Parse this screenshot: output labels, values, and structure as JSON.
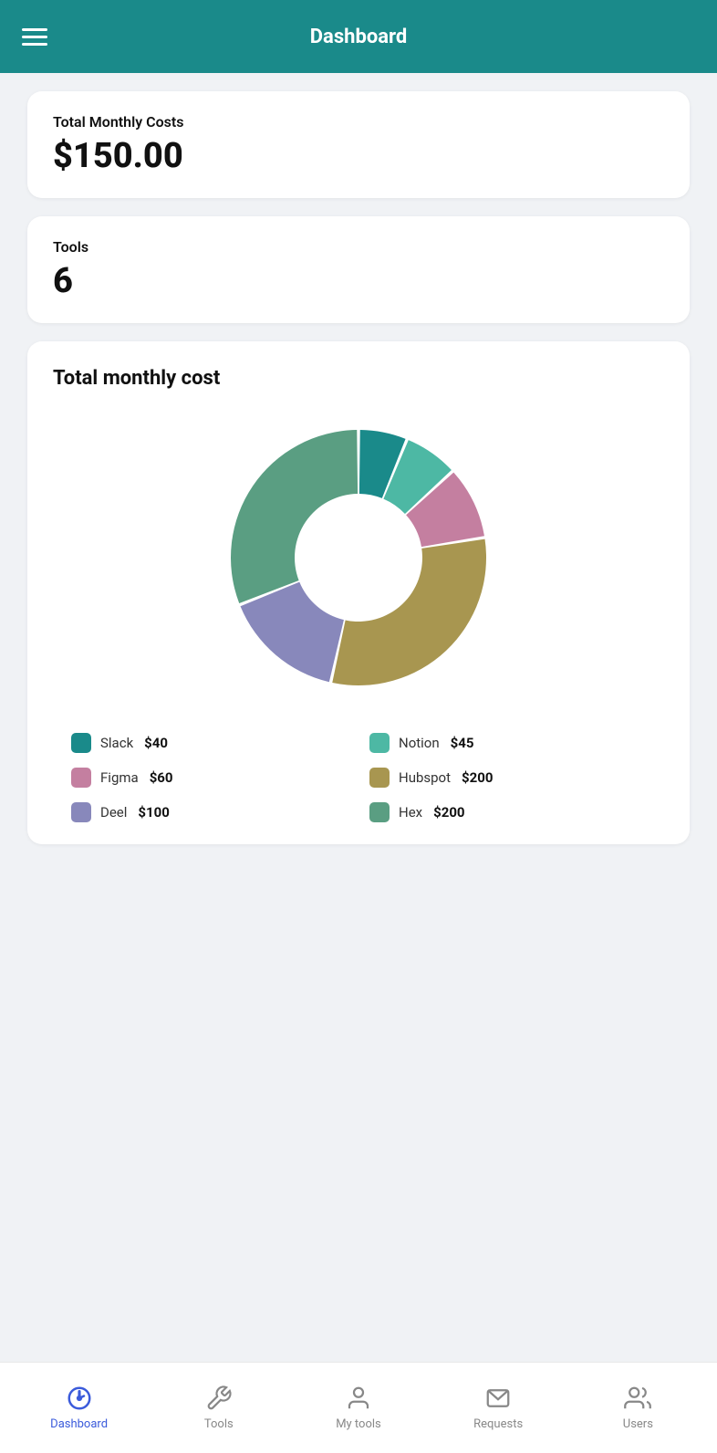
{
  "header": {
    "title": "Dashboard",
    "menu_label": "menu"
  },
  "stats": {
    "total_monthly_costs_label": "Total Monthly Costs",
    "total_monthly_costs_value": "$150.00",
    "tools_label": "Tools",
    "tools_value": "6"
  },
  "chart": {
    "title": "Total monthly cost",
    "segments": [
      {
        "name": "Slack",
        "value": 40,
        "color": "#1a8a8a",
        "display": "$40"
      },
      {
        "name": "Notion",
        "value": 45,
        "color": "#4db8a4",
        "display": "$45"
      },
      {
        "name": "Figma",
        "value": 60,
        "color": "#c47fa0",
        "display": "$60"
      },
      {
        "name": "Hubspot",
        "value": 200,
        "color": "#a89650",
        "display": "$200"
      },
      {
        "name": "Deel",
        "value": 100,
        "color": "#8888bb",
        "display": "$100"
      },
      {
        "name": "Hex",
        "value": 200,
        "color": "#5a9e82",
        "display": "$200"
      }
    ]
  },
  "bottom_nav": {
    "items": [
      {
        "label": "Dashboard",
        "icon": "dashboard-icon",
        "active": true
      },
      {
        "label": "Tools",
        "icon": "tools-icon",
        "active": false
      },
      {
        "label": "My tools",
        "icon": "mytools-icon",
        "active": false
      },
      {
        "label": "Requests",
        "icon": "requests-icon",
        "active": false
      },
      {
        "label": "Users",
        "icon": "users-icon",
        "active": false
      }
    ]
  }
}
